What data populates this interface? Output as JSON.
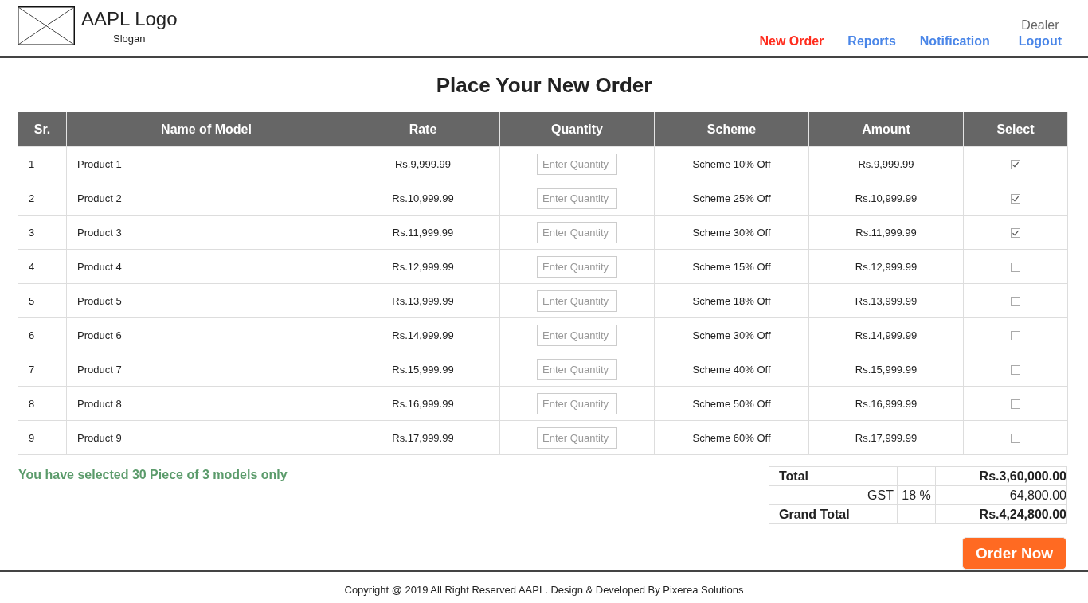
{
  "header": {
    "logo_text": "AAPL Logo",
    "slogan": "Slogan",
    "nav": [
      {
        "label": "New Order",
        "selected": true
      },
      {
        "label": "Reports",
        "selected": false
      },
      {
        "label": "Notification",
        "selected": false
      }
    ],
    "user": {
      "role": "Dealer",
      "logout": "Logout"
    }
  },
  "title": "Place Your New Order",
  "table": {
    "columns": [
      "Sr.",
      "Name of Model",
      "Rate",
      "Quantity",
      "Scheme",
      "Amount",
      "Select"
    ],
    "rows": [
      {
        "sr": "1",
        "model": "Product 1",
        "rate": "Rs.9,999.99",
        "quantity": {
          "placeholder": "Enter Quantity"
        },
        "scheme": "Scheme 10% Off",
        "amount": "Rs.9,999.99",
        "checked": true
      },
      {
        "sr": "2",
        "model": "Product 2",
        "rate": "Rs.10,999.99",
        "quantity": {
          "placeholder": "Enter Quantity"
        },
        "scheme": "Scheme 25% Off",
        "amount": "Rs.10,999.99",
        "checked": true
      },
      {
        "sr": "3",
        "model": "Product 3",
        "rate": "Rs.11,999.99",
        "quantity": {
          "placeholder": "Enter Quantity"
        },
        "scheme": "Scheme 30% Off",
        "amount": "Rs.11,999.99",
        "checked": true
      },
      {
        "sr": "4",
        "model": "Product 4",
        "rate": "Rs.12,999.99",
        "quantity": {
          "placeholder": "Enter Quantity"
        },
        "scheme": "Scheme 15% Off",
        "amount": "Rs.12,999.99",
        "checked": false
      },
      {
        "sr": "5",
        "model": "Product 5",
        "rate": "Rs.13,999.99",
        "quantity": {
          "placeholder": "Enter Quantity"
        },
        "scheme": "Scheme 18% Off",
        "amount": "Rs.13,999.99",
        "checked": false
      },
      {
        "sr": "6",
        "model": "Product 6",
        "rate": "Rs.14,999.99",
        "quantity": {
          "placeholder": "Enter Quantity"
        },
        "scheme": "Scheme 30% Off",
        "amount": "Rs.14,999.99",
        "checked": false
      },
      {
        "sr": "7",
        "model": "Product 7",
        "rate": "Rs.15,999.99",
        "quantity": {
          "placeholder": "Enter Quantity"
        },
        "scheme": "Scheme 40% Off",
        "amount": "Rs.15,999.99",
        "checked": false
      },
      {
        "sr": "8",
        "model": "Product 8",
        "rate": "Rs.16,999.99",
        "quantity": {
          "placeholder": "Enter Quantity"
        },
        "scheme": "Scheme 50% Off",
        "amount": "Rs.16,999.99",
        "checked": false
      },
      {
        "sr": "9",
        "model": "Product 9",
        "rate": "Rs.17,999.99",
        "quantity": {
          "placeholder": "Enter Quantity"
        },
        "scheme": "Scheme 60% Off",
        "amount": "Rs.17,999.99",
        "checked": false
      }
    ]
  },
  "selection_message": "You have selected 30 Piece of 3 models only",
  "totals": [
    {
      "kind": "total",
      "label": "Total",
      "value": "Rs.3,60,000.00"
    },
    {
      "kind": "tax",
      "label": "GST",
      "rate": "18 %",
      "value": "64,800.00"
    },
    {
      "kind": "total",
      "label": "Grand Total",
      "value": "Rs.4,24,800.00"
    }
  ],
  "order_button": "Order Now",
  "footer": {
    "copyright": "Copyright @ 2019 All Right Reserved AAPL. Design & Developed By Pixerea Solutions"
  }
}
